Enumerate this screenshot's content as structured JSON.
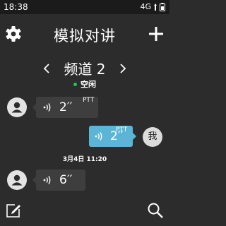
{
  "status_bar": {
    "time": "18:38",
    "network": "4G"
  },
  "header": {
    "title": "模拟对讲",
    "settings_icon": "gear-icon",
    "add_icon": "plus-icon"
  },
  "channel": {
    "name": "频道 2",
    "state": "空闲",
    "state_color": "#22c35a"
  },
  "messages": [
    {
      "direction": "incoming",
      "duration": "2′′",
      "tag": "PTT"
    },
    {
      "direction": "outgoing",
      "duration": "2′′",
      "tag": "PTT",
      "sender_label": "我"
    },
    {
      "timestamp": "3月4日  11:20"
    },
    {
      "direction": "incoming",
      "duration": "6′′"
    }
  ],
  "footer": {
    "left_icon": "edit-icon",
    "right_icon": "search-icon"
  },
  "colors": {
    "background": "#2c2c2c",
    "status_bar": "#1b1b1b",
    "incoming_bubble": "#3e3e3e",
    "outgoing_bubble": "#5ab5d6"
  }
}
